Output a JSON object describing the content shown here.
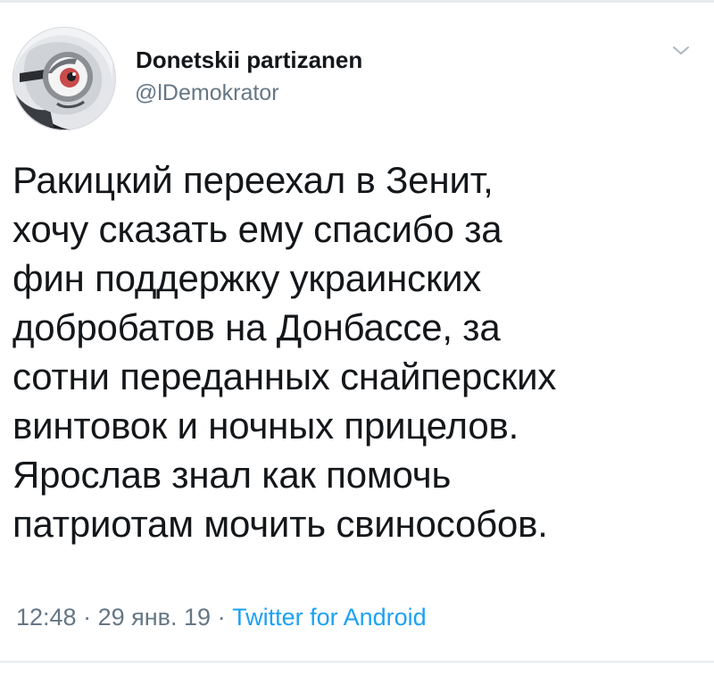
{
  "author": {
    "display_name": "Donetskii partizanen",
    "handle": "@lDemokrator",
    "avatar_icon": "cartoon-character-avatar"
  },
  "menu_icon": "chevron-down-icon",
  "tweet": {
    "lines": [
      "Ракицкий переехал в Зенит,",
      "хочу сказать ему спасибо за",
      "фин поддержку украинских",
      "добробатов на Донбассе, за",
      "сотни переданных снайперских",
      "винтовок и ночных прицелов.",
      "Ярослав знал как помочь",
      "патриотам мочить свинособов."
    ]
  },
  "meta": {
    "time": "12:48",
    "separator": "·",
    "date": "29 янв. 19",
    "source": "Twitter for Android"
  },
  "colors": {
    "text": "#14171a",
    "secondary": "#657786",
    "link": "#1da1f2",
    "divider": "#e6ecf0"
  }
}
